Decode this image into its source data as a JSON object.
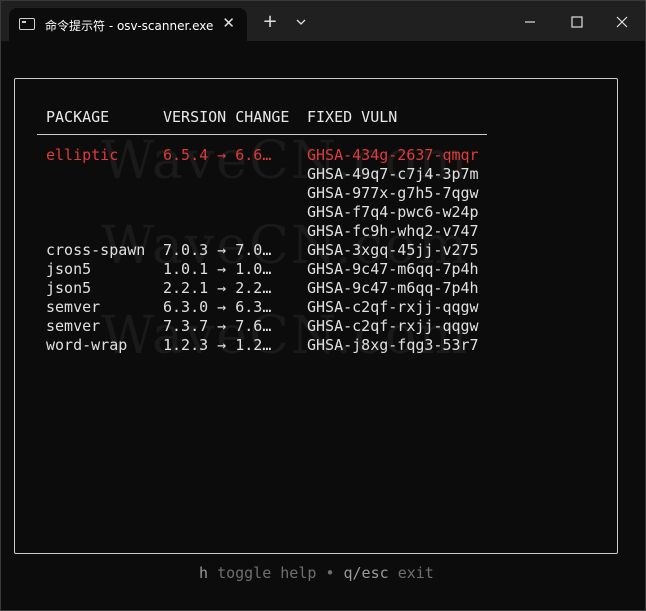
{
  "window": {
    "tab_title": "命令提示符 - osv-scanner.exe",
    "new_tab_glyph": "+",
    "tab_close_glyph": "✕"
  },
  "watermark": {
    "text": "WaveCN.com"
  },
  "table": {
    "headers": {
      "package": "PACKAGE",
      "version_change": "VERSION CHANGE",
      "fixed_vuln": "FIXED VULN"
    },
    "rows": [
      {
        "package": "elliptic",
        "version": "6.5.4 → 6.6…",
        "vuln": "GHSA-434g-2637-qmqr"
      },
      {
        "package": "",
        "version": "",
        "vuln": "GHSA-49q7-c7j4-3p7m"
      },
      {
        "package": "",
        "version": "",
        "vuln": "GHSA-977x-g7h5-7qgw"
      },
      {
        "package": "",
        "version": "",
        "vuln": "GHSA-f7q4-pwc6-w24p"
      },
      {
        "package": "",
        "version": "",
        "vuln": "GHSA-fc9h-whq2-v747"
      },
      {
        "package": "cross-spawn",
        "version": "7.0.3 → 7.0…",
        "vuln": "GHSA-3xgq-45jj-v275"
      },
      {
        "package": "json5",
        "version": "1.0.1 → 1.0…",
        "vuln": "GHSA-9c47-m6qq-7p4h"
      },
      {
        "package": "json5",
        "version": "2.2.1 → 2.2…",
        "vuln": "GHSA-9c47-m6qq-7p4h"
      },
      {
        "package": "semver",
        "version": "6.3.0 → 6.3…",
        "vuln": "GHSA-c2qf-rxjj-qqgw"
      },
      {
        "package": "semver",
        "version": "7.3.7 → 7.6…",
        "vuln": "GHSA-c2qf-rxjj-qqgw"
      },
      {
        "package": "word-wrap",
        "version": "1.2.3 → 1.2…",
        "vuln": "GHSA-j8xg-fqg3-53r7"
      }
    ]
  },
  "help": {
    "toggle_key": "h",
    "toggle_label": "toggle help",
    "separator": "•",
    "exit_key": "q/esc",
    "exit_label": "exit"
  },
  "colors": {
    "selected_row": "#e03a3a",
    "background": "#0c0c0c",
    "titlebar": "#202020"
  }
}
